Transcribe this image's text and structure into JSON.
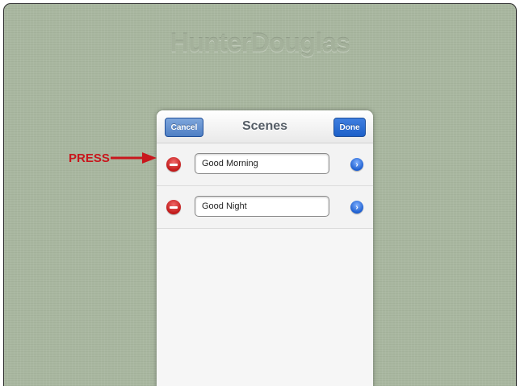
{
  "brand": {
    "logo_text": "HunterDouglas"
  },
  "dialog": {
    "title": "Scenes",
    "cancel_label": "Cancel",
    "done_label": "Done"
  },
  "scenes": [
    {
      "name": "Good Morning"
    },
    {
      "name": "Good Night"
    }
  ],
  "annotation": {
    "label": "PRESS",
    "color": "#c8171d"
  },
  "colors": {
    "background": "#a9b7a0",
    "delete": "#d12a2a",
    "accent_blue": "#1c5fc8"
  },
  "icons": {
    "delete": "minus-circle-icon",
    "disclosure": "chevron-right-circle-icon",
    "arrow": "arrow-right-icon"
  }
}
